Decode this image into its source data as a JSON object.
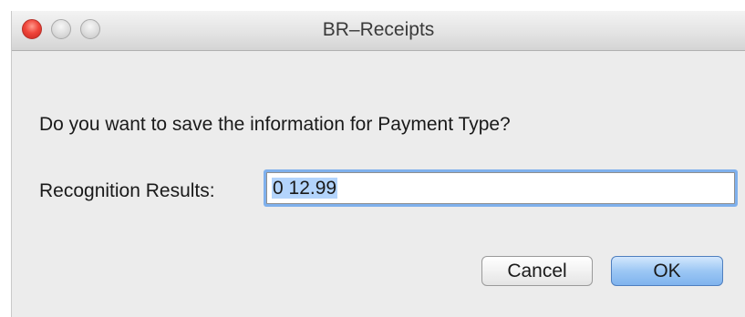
{
  "window": {
    "title": "BR–Receipts"
  },
  "dialog": {
    "prompt": "Do you want to save the information for Payment Type?",
    "field_label": "Recognition Results:",
    "field_value": "0 12.99"
  },
  "buttons": {
    "cancel_label": "Cancel",
    "ok_label": "OK"
  },
  "colors": {
    "window_bg": "#ececec",
    "close_button": "#f0463b",
    "focus_ring": "#7fb0ec",
    "default_button": "#9cc7f4",
    "text_selection": "#b3d4fc"
  }
}
